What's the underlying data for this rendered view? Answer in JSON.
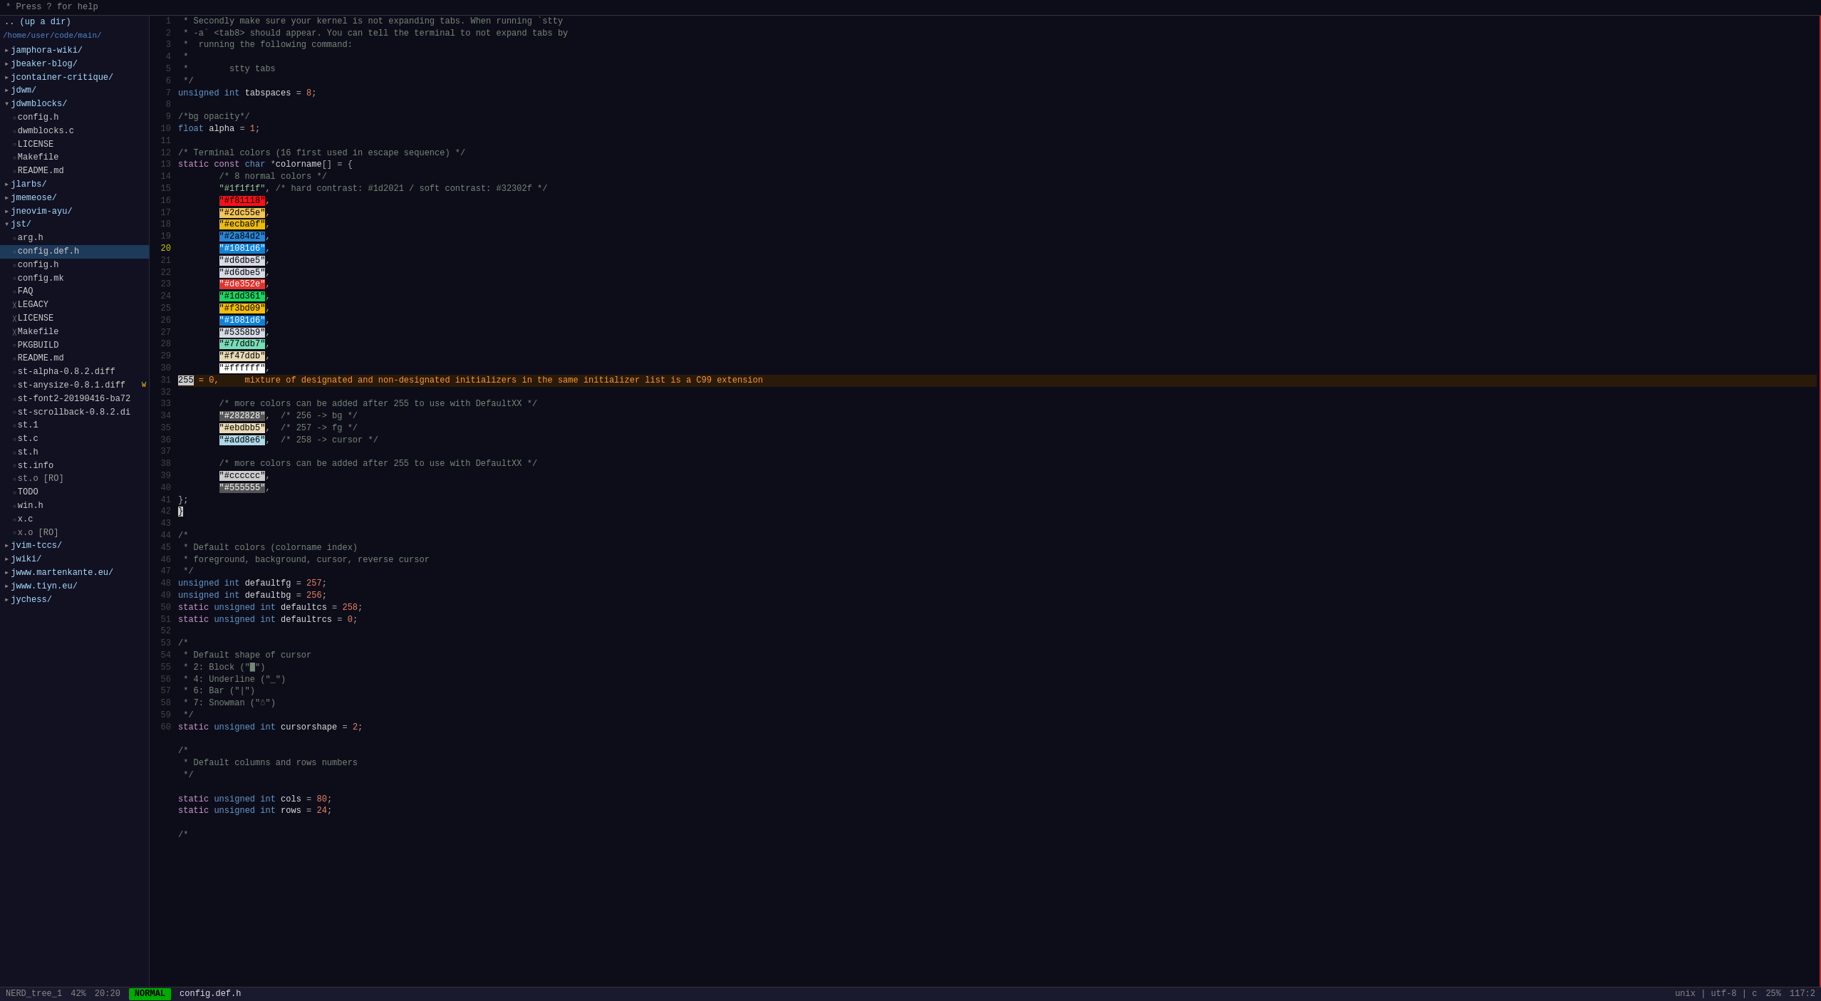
{
  "topbar": {
    "help_text": "* Press ? for help"
  },
  "sidebar": {
    "cwd": ".. (up a dir)",
    "path": "/home/user/code/main/",
    "items": [
      {
        "id": "jamphora-wiki",
        "label": "jamphora-wiki/",
        "type": "dir",
        "indent": 1
      },
      {
        "id": "beaker-blog",
        "label": "jbeaker-blog/",
        "type": "dir",
        "indent": 1
      },
      {
        "id": "container-critique",
        "label": "jcontainer-critique/",
        "type": "dir",
        "indent": 1
      },
      {
        "id": "jdwm",
        "label": "jdwm/",
        "type": "dir",
        "indent": 1
      },
      {
        "id": "jdwmblocks",
        "label": "jdwmblocks/",
        "type": "dir",
        "indent": 1,
        "open": true
      },
      {
        "id": "config.h",
        "label": "config.h",
        "type": "file",
        "indent": 2
      },
      {
        "id": "dwmblocks.c",
        "label": "dwmblocks.c",
        "type": "file",
        "indent": 2
      },
      {
        "id": "LICENSE",
        "label": "LICENSE",
        "type": "file",
        "indent": 2
      },
      {
        "id": "Makefile",
        "label": "Makefile",
        "type": "file",
        "indent": 2
      },
      {
        "id": "README.md",
        "label": "README.md",
        "type": "file",
        "indent": 2
      },
      {
        "id": "jlarbs",
        "label": "jlarbs/",
        "type": "dir",
        "indent": 1
      },
      {
        "id": "jmemeose",
        "label": "jmemeose/",
        "type": "dir",
        "indent": 1
      },
      {
        "id": "jneovim-ayu",
        "label": "jneovim-ayu/",
        "type": "dir",
        "indent": 1
      },
      {
        "id": "jst",
        "label": "jst/",
        "type": "dir",
        "indent": 1,
        "open": true
      },
      {
        "id": "arg.h",
        "label": "arg.h",
        "type": "file",
        "indent": 2
      },
      {
        "id": "config.def.h",
        "label": "config.def.h",
        "type": "file",
        "indent": 2,
        "selected": true
      },
      {
        "id": "config.h2",
        "label": "config.h",
        "type": "file",
        "indent": 2
      },
      {
        "id": "config.mk",
        "label": "config.mk",
        "type": "file",
        "indent": 2
      },
      {
        "id": "FAQ",
        "label": "FAQ",
        "type": "file",
        "indent": 2
      },
      {
        "id": "LEGACY",
        "label": "LEGACY",
        "type": "file",
        "indent": 2
      },
      {
        "id": "LICENSE2",
        "label": "LICENSE",
        "type": "file",
        "indent": 2
      },
      {
        "id": "Makefile2",
        "label": "Makefile",
        "type": "file",
        "indent": 2
      },
      {
        "id": "PKGBUILD",
        "label": "PKGBUILD",
        "type": "file",
        "indent": 2
      },
      {
        "id": "README.md2",
        "label": "README.md",
        "type": "file",
        "indent": 2
      },
      {
        "id": "st-alpha-0.8.2.diff",
        "label": "st-alpha-0.8.2.diff",
        "type": "file",
        "indent": 2
      },
      {
        "id": "st-anysize-0.8.1.diff",
        "label": "st-anysize-0.8.1.diff",
        "type": "file",
        "indent": 2,
        "modified": true
      },
      {
        "id": "st-font2-20190416-ba72",
        "label": "st-font2-20190416-ba72",
        "type": "file",
        "indent": 2
      },
      {
        "id": "st-scrollback-0.8.2.di",
        "label": "st-scrollback-0.8.2.di",
        "type": "file",
        "indent": 2
      },
      {
        "id": "st.1",
        "label": "st.1",
        "type": "file",
        "indent": 2
      },
      {
        "id": "st.c",
        "label": "st.c",
        "type": "file",
        "indent": 2
      },
      {
        "id": "st.h",
        "label": "st.h",
        "type": "file",
        "indent": 2
      },
      {
        "id": "st.info",
        "label": "st.info",
        "type": "file",
        "indent": 2
      },
      {
        "id": "st.o",
        "label": "st.o [RO]",
        "type": "readonly",
        "indent": 2
      },
      {
        "id": "TODO",
        "label": "TODO",
        "type": "file",
        "indent": 2
      },
      {
        "id": "win.h",
        "label": "win.h",
        "type": "file",
        "indent": 2
      },
      {
        "id": "x.c",
        "label": "x.c",
        "type": "file",
        "indent": 2
      },
      {
        "id": "x.o",
        "label": "x.o [RO]",
        "type": "readonly",
        "indent": 2
      },
      {
        "id": "jvim-tccs",
        "label": "jvim-tccs/",
        "type": "dir",
        "indent": 1
      },
      {
        "id": "jwiki",
        "label": "jwiki/",
        "type": "dir",
        "indent": 1
      },
      {
        "id": "jwww.martenkante.eu",
        "label": "jwww.martenkante.eu/",
        "type": "dir",
        "indent": 1
      },
      {
        "id": "jwww.tiyn.eu",
        "label": "jwww.tiyn.eu/",
        "type": "dir",
        "indent": 1
      },
      {
        "id": "jychess",
        "label": "jychess/",
        "type": "dir",
        "indent": 1
      }
    ]
  },
  "editor": {
    "filename": "config.def.h",
    "mode": "NORMAL",
    "encoding": "unix | utf-8 | c",
    "percent": "25%",
    "position": "117:2",
    "line_col": "20:20"
  },
  "statusbar": {
    "tree": "NERD_tree_1",
    "percent": "42%",
    "lineinfo": "20:20",
    "mode": "NORMAL",
    "filename": "config.def.h",
    "fileinfo": "unix | utf-8 | c",
    "rightpercent": "25%",
    "rightpos": "117:2"
  }
}
